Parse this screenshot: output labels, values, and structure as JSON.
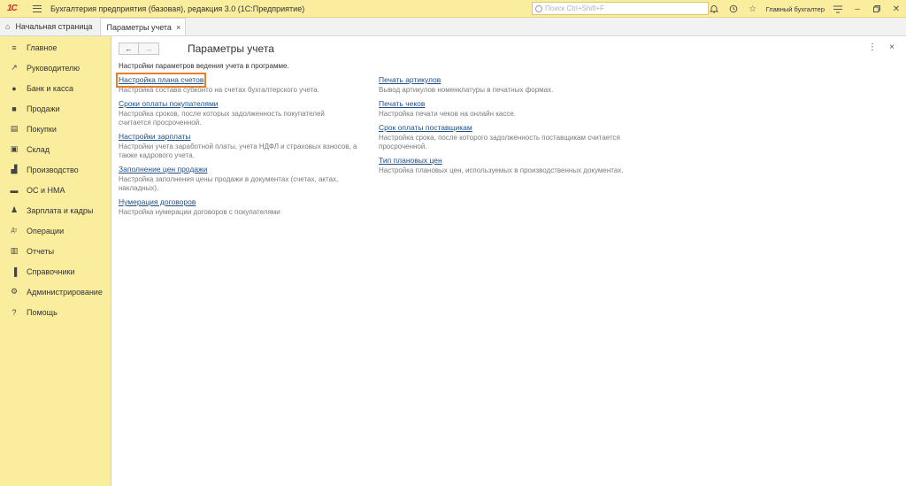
{
  "titlebar": {
    "logo": "1С",
    "app_title": "Бухгалтерия предприятия (базовая), редакция 3.0  (1С:Предприятие)",
    "search_placeholder": "Поиск Ctrl+Shift+F",
    "user": "Главный бухгалтер"
  },
  "tabs": {
    "home": "Начальная страница",
    "active": "Параметры учета"
  },
  "sidebar": {
    "items": [
      {
        "label": "Главное",
        "icon": "list-icon"
      },
      {
        "label": "Руководителю",
        "icon": "trend-icon"
      },
      {
        "label": "Банк и касса",
        "icon": "coins-icon"
      },
      {
        "label": "Продажи",
        "icon": "bag-icon"
      },
      {
        "label": "Покупки",
        "icon": "cart-icon"
      },
      {
        "label": "Склад",
        "icon": "box-icon"
      },
      {
        "label": "Производство",
        "icon": "factory-icon"
      },
      {
        "label": "ОС и НМА",
        "icon": "truck-icon"
      },
      {
        "label": "Зарплата и кадры",
        "icon": "person-icon"
      },
      {
        "label": "Операции",
        "icon": "dt-kt-icon"
      },
      {
        "label": "Отчеты",
        "icon": "bar-chart-icon"
      },
      {
        "label": "Справочники",
        "icon": "book-icon"
      },
      {
        "label": "Администрирование",
        "icon": "gear-icon"
      },
      {
        "label": "Помощь",
        "icon": "question-icon"
      }
    ]
  },
  "main": {
    "title": "Параметры учета",
    "subtitle": "Настройки параметров ведения учета в программе.",
    "left_items": [
      {
        "link": "Настройка плана счетов",
        "desc": "Настройка состава субконто на счетах бухгалтерского учета."
      },
      {
        "link": "Сроки оплаты покупателями",
        "desc": "Настройка сроков, после которых задолженность покупателей считается просроченной."
      },
      {
        "link": "Настройки зарплаты",
        "desc": "Настройки учета заработной платы, учета НДФЛ и страховых взносов, а также кадрового учета."
      },
      {
        "link": "Заполнение цен продажи",
        "desc": "Настройка заполнения цены продажи в документах (счетах, актах, накладных)."
      },
      {
        "link": "Нумерация договоров",
        "desc": "Настройка нумерации договоров с покупателями"
      }
    ],
    "right_items": [
      {
        "link": "Печать артикулов",
        "desc": "Вывод артикулов номенклатуры в печатных формах."
      },
      {
        "link": "Печать чеков",
        "desc": "Настройка печати чеков на онлайн кассе."
      },
      {
        "link": "Срок оплаты поставщикам",
        "desc": "Настройка срока, после которого задолженность поставщикам считается просроченной."
      },
      {
        "link": "Тип плановых цен",
        "desc": "Настройка плановых цен, используемых в производственных документах."
      }
    ]
  },
  "colors": {
    "accent_yellow": "#fbed9e",
    "link": "#1f4f87",
    "highlight": "#e8802a"
  }
}
